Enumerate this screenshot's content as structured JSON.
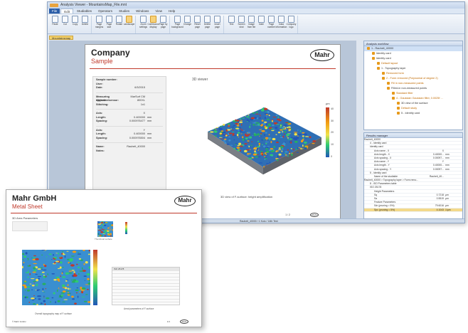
{
  "window": {
    "title": "Analysis Viewer - MountainsMap_File.mnt"
  },
  "menu": {
    "items": [
      "File",
      "Edit",
      "Studiables",
      "Operators",
      "Studies",
      "Windows",
      "View",
      "Help"
    ]
  },
  "ribbon": {
    "buttons": [
      "Paste",
      "Cut",
      "Copy",
      "Delete",
      "Page margins",
      "Page size",
      "Rotate",
      "Landscape",
      "Zoom settings",
      "Continuous display",
      "Page by page",
      "Page background",
      "Change",
      "Reset page",
      "Delete page",
      "Insert page",
      "Text",
      "Screen shot",
      "Image from file",
      "Date",
      "Page number",
      "Data information",
      "Company logo"
    ]
  },
  "doc_tab": "Mountainsmap",
  "report1": {
    "company": "Company",
    "subtitle": "Sample",
    "logo": "Mahr",
    "info": [
      {
        "k": "Sample number:",
        "v": "",
        "u": ""
      },
      {
        "k": "User:",
        "v": "",
        "u": ""
      },
      {
        "k": "Date:",
        "v": "6/3/2015",
        "u": ""
      },
      {
        "k": "Measuring system:",
        "v": "MarSurf CM",
        "u": ""
      },
      {
        "k": "Objective/sensor:",
        "v": "800XL",
        "u": ""
      },
      {
        "k": "Stitching:",
        "v": "1x1",
        "u": ""
      },
      {
        "k": "Axis:",
        "v": "X",
        "u": ""
      },
      {
        "k": "Length:",
        "v": "0.400000",
        "u": "mm"
      },
      {
        "k": "Spacing:",
        "v": "0.000976477",
        "u": "mm"
      },
      {
        "k": "Axis:",
        "v": "Y",
        "u": ""
      },
      {
        "k": "Length:",
        "v": "0.400000",
        "u": "mm"
      },
      {
        "k": "Spacing:",
        "v": "0.000976504",
        "u": "mm"
      },
      {
        "k": "Name:",
        "v": "Rauheit_40000",
        "u": ""
      },
      {
        "k": "Notes:",
        "v": "",
        "u": ""
      }
    ],
    "viewer_title": "3D viewer",
    "viewer_caption": "3D view of F-surface: height amplification",
    "page_label": "1 / 2",
    "unit_label": "µm",
    "colorbar_ticks": [
      "40",
      "30",
      "20",
      "10",
      "0"
    ]
  },
  "statusbar": "Rauheit_40000 / 1 Kolo / 14th Text",
  "analysis_panel": {
    "title": "Analysis workflow",
    "items": [
      {
        "label": "1 - Rauheit_40000",
        "level": 0,
        "orange": false,
        "sel": true
      },
      {
        "label": "Identity card",
        "level": 1,
        "orange": false,
        "sel": false
      },
      {
        "label": "Identity card",
        "level": 1,
        "orange": false,
        "sel": false
      },
      {
        "label": "Default layout",
        "level": 2,
        "orange": true,
        "sel": false
      },
      {
        "label": "1 - Topography layer",
        "level": 2,
        "orange": false,
        "sel": false
      },
      {
        "label": "Removed form",
        "level": 3,
        "orange": true,
        "sel": false
      },
      {
        "label": "2 - Form removed (Polynomial of degree 2)",
        "level": 3,
        "orange": true,
        "sel": false
      },
      {
        "label": "Fill in non-measured points",
        "level": 4,
        "orange": true,
        "sel": false
      },
      {
        "label": "Filled-in non-measured points",
        "level": 4,
        "orange": false,
        "sel": false
      },
      {
        "label": "Standard filter",
        "level": 5,
        "orange": true,
        "sel": false
      },
      {
        "label": "4 - Gaussian Gaussian filter, 0.0025f ...",
        "level": 5,
        "orange": true,
        "sel": false
      },
      {
        "label": "3D view of the surface",
        "level": 6,
        "orange": false,
        "sel": false
      },
      {
        "label": "Default study",
        "level": 6,
        "orange": true,
        "sel": false
      },
      {
        "label": "5 - Identity card",
        "level": 6,
        "orange": false,
        "sel": false
      }
    ]
  },
  "results_panel": {
    "title": "Results manager",
    "rows": [
      {
        "n": "Rauheit_40000",
        "v": "",
        "u": "",
        "lvl": 0,
        "sel": false
      },
      {
        "n": "4 - Identity card",
        "v": "",
        "u": "",
        "lvl": 1,
        "sel": false
      },
      {
        "n": "Identity card",
        "v": "",
        "u": "",
        "lvl": 1,
        "sel": false
      },
      {
        "n": "Axis name - X",
        "v": "X",
        "u": "",
        "lvl": 2,
        "sel": false
      },
      {
        "n": "Axis length - X",
        "v": "0.40000...",
        "u": "mm",
        "lvl": 2,
        "sel": false
      },
      {
        "n": "Axis spacing - X",
        "v": "0.00097...",
        "u": "mm",
        "lvl": 2,
        "sel": false
      },
      {
        "n": "Axis name - Y",
        "v": "Y",
        "u": "",
        "lvl": 2,
        "sel": false
      },
      {
        "n": "Axis length - Y",
        "v": "0.40000...",
        "u": "mm",
        "lvl": 2,
        "sel": false
      },
      {
        "n": "Axis spacing - Y",
        "v": "0.00097...",
        "u": "mm",
        "lvl": 2,
        "sel": false
      },
      {
        "n": "5 - Identity card",
        "v": "",
        "u": "",
        "lvl": 1,
        "sel": false
      },
      {
        "n": "Name of the studiable",
        "v": "Rauheit_40...",
        "u": "",
        "lvl": 2,
        "sel": false
      },
      {
        "n": "Rauheit_40000 > Topography layer > Form remo...",
        "v": "",
        "u": "",
        "lvl": 0,
        "sel": false
      },
      {
        "n": "8 - ISO Parameters table",
        "v": "",
        "u": "",
        "lvl": 1,
        "sel": false
      },
      {
        "n": "ISO 25178",
        "v": "",
        "u": "",
        "lvl": 1,
        "sel": false
      },
      {
        "n": "Height Parameters",
        "v": "",
        "u": "",
        "lvl": 2,
        "sel": false
      },
      {
        "n": "Sq",
        "v": "0.7218",
        "u": "µm",
        "lvl": 2,
        "sel": false
      },
      {
        "n": "Sa",
        "v": "0.5519",
        "u": "µm",
        "lvl": 2,
        "sel": false
      },
      {
        "n": "Feature Parameters",
        "v": "",
        "u": "",
        "lvl": 2,
        "sel": false
      },
      {
        "n": "Sdr (pruning = 5%)",
        "v": "79.6016",
        "u": "µm",
        "lvl": 2,
        "sel": false
      },
      {
        "n": "Spc (pruning = 5%)",
        "v": "4.1043",
        "u": "1/µm",
        "lvl": 2,
        "sel": true
      }
    ]
  },
  "report2": {
    "company": "Mahr GmbH",
    "subtitle": "Metal Sheet",
    "logo": "Mahr",
    "section": "3D Area Parameters",
    "thumb_caption": "Thumbnail surface",
    "table_title": "ISO 25178",
    "caption_map": "Overall topography map of F-surface",
    "caption_table": "Areal parameters of F-surface",
    "footer_left": "© Mahr GmbH",
    "page_label": "1/1"
  },
  "colors": {
    "accent_red": "#c0392b",
    "ribbon_bg": "#dfe7f2",
    "panel_border": "#97aecb"
  }
}
